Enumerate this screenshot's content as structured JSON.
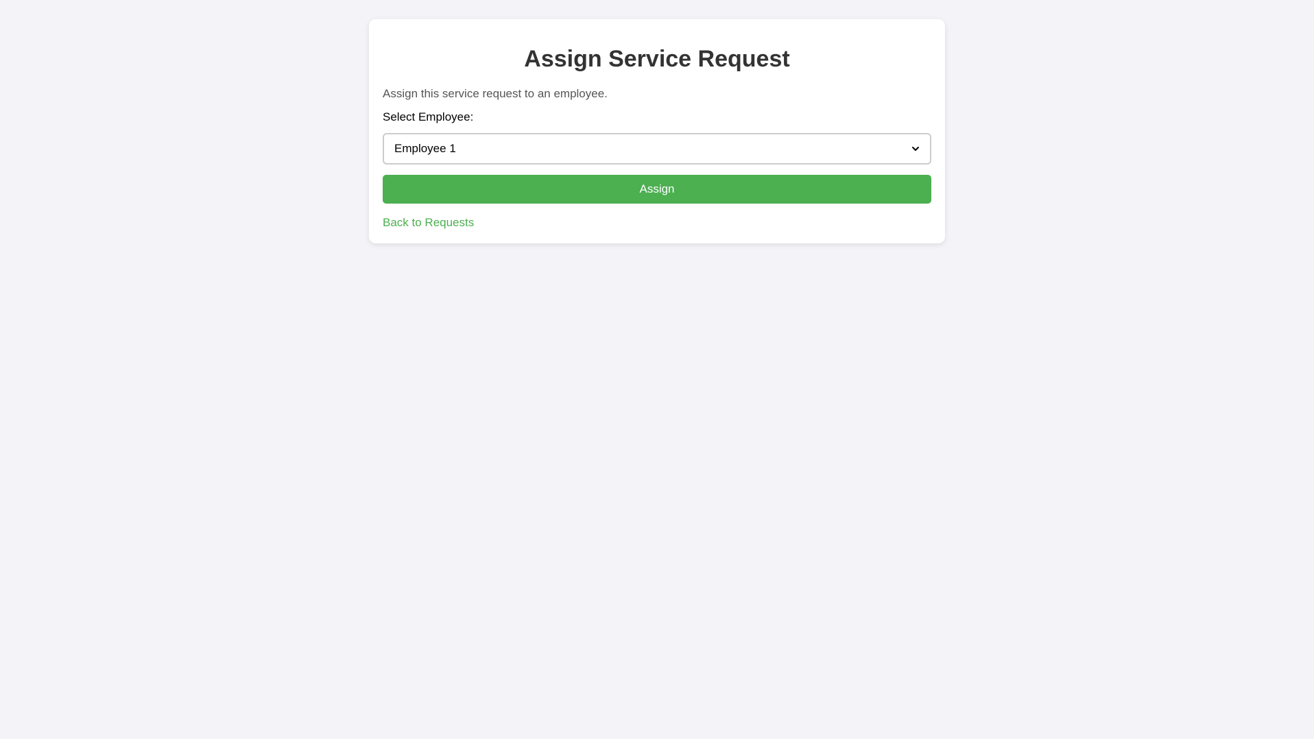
{
  "form": {
    "title": "Assign Service Request",
    "description": "Assign this service request to an employee.",
    "employee_label": "Select Employee:",
    "selected_employee": "Employee 1",
    "assign_button": "Assign",
    "back_link": "Back to Requests"
  },
  "colors": {
    "accent": "#4caf50",
    "background": "#f4f4f8",
    "card": "#ffffff",
    "title": "#333333"
  },
  "icons": {
    "select_arrow": "chevron-down-icon"
  }
}
